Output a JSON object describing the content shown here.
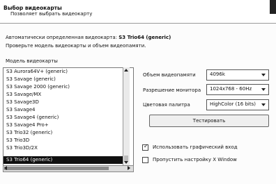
{
  "header": {
    "title": "Выбор видеокарты",
    "subtitle": "Позволяет выбрать видеокарту"
  },
  "detected": {
    "label": "Автоматически определенная видеокарта:",
    "value": "S3 Trio64 (generic)"
  },
  "hint": "Проверьте модель видеокарты и объем видеопамяти.",
  "card_list": {
    "label": "Модель видеокарты",
    "items": [
      "S3 Aurora64V+ (generic)",
      "S3 Savage (generic)",
      "S3 Savage 2000 (generic)",
      "S3 Savage/MX",
      "S3 Savage3D",
      "S3 Savage4",
      "S3 Savage4 (generic)",
      "S3 Savage4 Pro+",
      "S3 Trio32 (generic)",
      "S3 Trio3D",
      "S3 Trio3D/2X",
      "S3 Trio64 (generic)"
    ],
    "selected_index": 11
  },
  "settings": {
    "memory": {
      "label": "Объем видеопамяти",
      "value": "4096k"
    },
    "resolution": {
      "label": "Разрешение монитора",
      "value": "1024x768 - 60Hz"
    },
    "palette": {
      "label": "Цветовая палитра",
      "value": "HighColor (16 bits)"
    }
  },
  "test_button": "Тестировать",
  "options": {
    "graphical_login": {
      "label": "Использовать графический вход",
      "checked": true
    },
    "skip_xwindow": {
      "label": "Пропустить настройку X Window",
      "checked": false
    }
  }
}
